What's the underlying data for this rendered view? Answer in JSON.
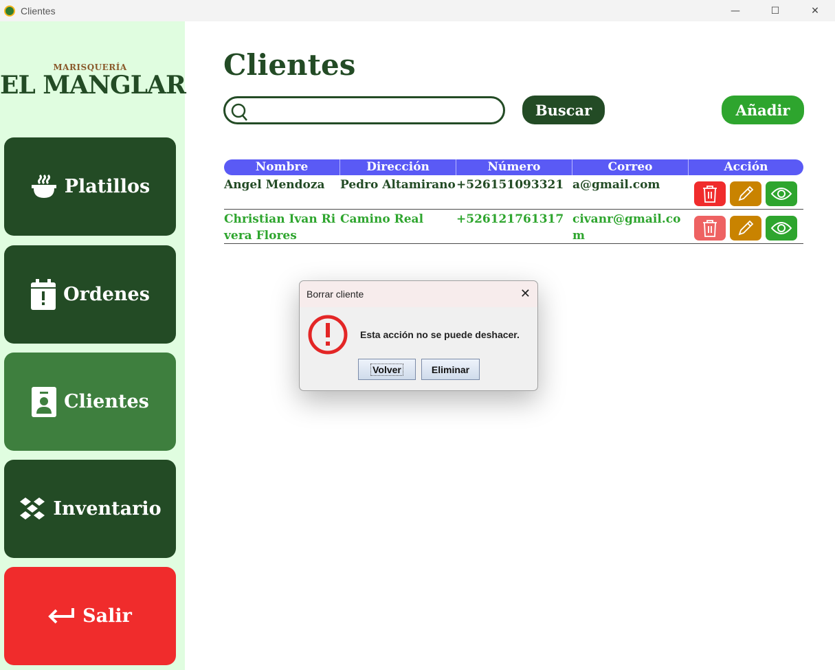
{
  "window": {
    "title": "Clientes",
    "minimize": "—",
    "maximize": "☐",
    "close": "✕"
  },
  "sidebar": {
    "logo_sub": "MARISQUERÍA",
    "logo_main": "EL MANGLAR",
    "items": [
      {
        "label": "Platillos",
        "icon": "bowl-icon"
      },
      {
        "label": "Ordenes",
        "icon": "calendar-icon"
      },
      {
        "label": "Clientes",
        "icon": "contact-icon",
        "active": true
      },
      {
        "label": "Inventario",
        "icon": "boxes-icon"
      },
      {
        "label": "Salir",
        "icon": "return-arrow-icon"
      }
    ]
  },
  "main": {
    "title": "Clientes",
    "search": {
      "value": "",
      "placeholder": ""
    },
    "buscar_label": "Buscar",
    "anadir_label": "Añadir"
  },
  "table": {
    "columns": [
      "Nombre",
      "Dirección",
      "Número",
      "Correo",
      "Acción"
    ],
    "rows": [
      {
        "nombre": "Angel Mendoza",
        "direccion": "Pedro Altamirano",
        "numero": "+526151093321",
        "correo": "a@gmail.com"
      },
      {
        "nombre": "Christian Ivan Rivera Flores",
        "direccion": "Camino Real",
        "numero": "+526121761317",
        "correo": "civanr@gmail.com"
      }
    ]
  },
  "dialog": {
    "title": "Borrar cliente",
    "close": "✕",
    "message": "Esta acción no se puede deshacer.",
    "volver_label": "Volver",
    "eliminar_label": "Eliminar"
  },
  "colors": {
    "dark_green": "#234b25",
    "active_green": "#3e7f3e",
    "bright_green": "#2ea52e",
    "sidebar_bg": "#e0fde0",
    "red": "#f02c2c",
    "orange": "#c98300",
    "header_blue": "#5a5af5"
  }
}
